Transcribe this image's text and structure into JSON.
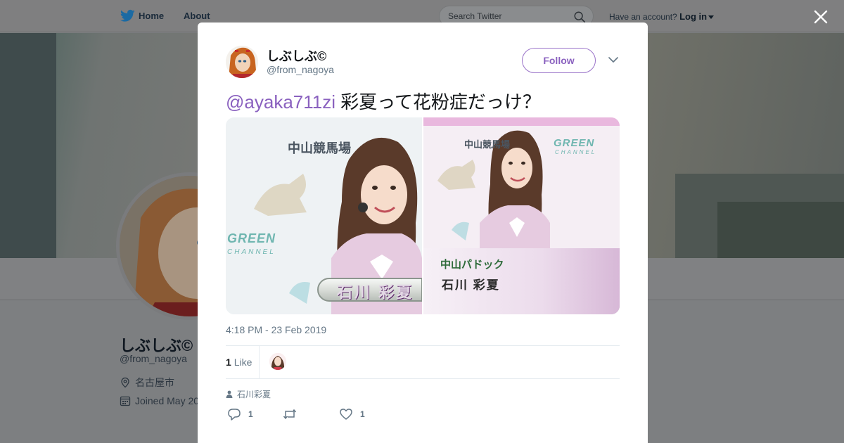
{
  "header": {
    "nav": [
      {
        "label": "Home",
        "icon": "twitter-bird-icon"
      },
      {
        "label": "About"
      }
    ],
    "search_placeholder": "Search Twitter",
    "account_prompt": "Have an account?",
    "login_label": "Log in"
  },
  "profile": {
    "name": "しぶしぶ©",
    "handle": "@from_nagoya",
    "location": "名古屋市",
    "joined": "Joined May 20"
  },
  "tweet": {
    "author_name": "しぶしぶ©",
    "author_handle": "@from_nagoya",
    "follow_label": "Follow",
    "mention": "@ayaka711zi",
    "body": " 彩夏って花粉症だっけ？",
    "media": {
      "left_photo": {
        "logo_jra": "中山競馬場",
        "logo_green": "GREEN",
        "logo_channel": "CHANNEL",
        "caption": "石川 彩夏"
      },
      "right_photo": {
        "logo_jra": "中山競馬場",
        "logo_green": "GREEN",
        "logo_channel": "CHANNEL",
        "caption_line1": "中山パドック",
        "caption_line2": "石川 彩夏"
      }
    },
    "timestamp": "4:18 PM - 23 Feb 2019",
    "likes_count": "1",
    "likes_label": "Like",
    "reply_context": "石川彩夏",
    "actions": {
      "reply_count": "1",
      "retweet_count": "",
      "like_count": "1"
    }
  },
  "colors": {
    "accent": "#8a61bf",
    "twitter_blue": "#1da1f2",
    "muted": "#657786"
  }
}
